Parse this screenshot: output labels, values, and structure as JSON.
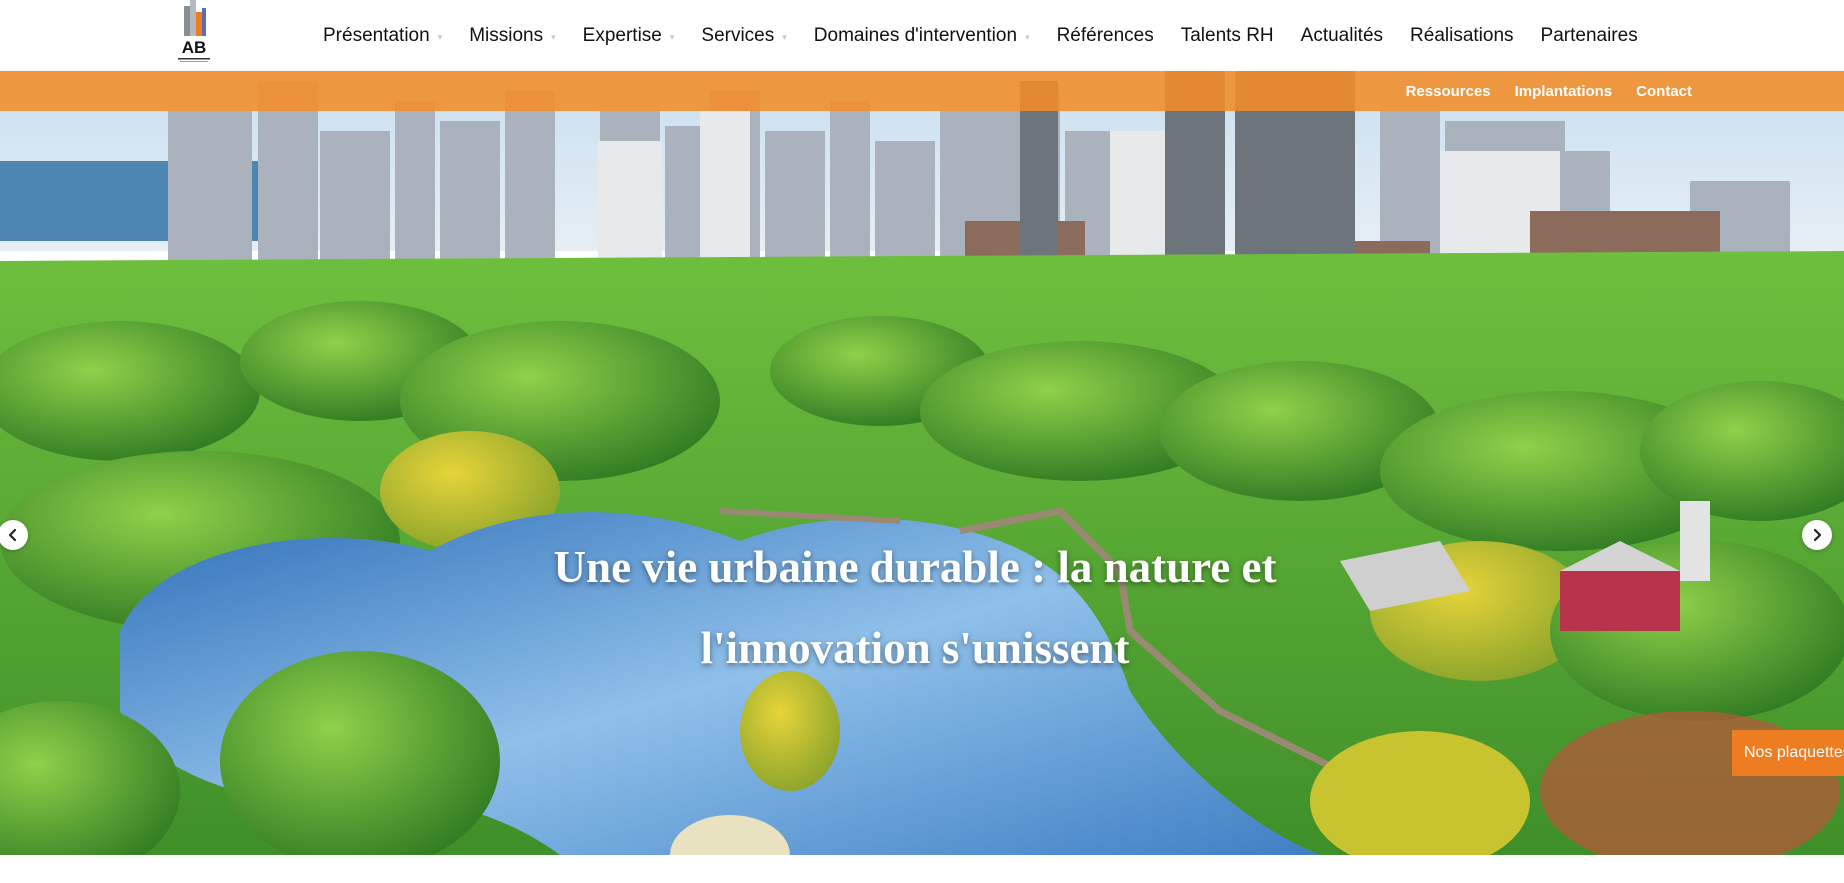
{
  "header": {
    "logo_text": "AB",
    "menu": [
      {
        "label": "Présentation",
        "has_dropdown": true
      },
      {
        "label": "Missions",
        "has_dropdown": true
      },
      {
        "label": "Expertise",
        "has_dropdown": true
      },
      {
        "label": "Services",
        "has_dropdown": true
      },
      {
        "label": "Domaines d'intervention",
        "has_dropdown": true
      },
      {
        "label": "Références",
        "has_dropdown": false
      },
      {
        "label": "Talents RH",
        "has_dropdown": false
      },
      {
        "label": "Actualités",
        "has_dropdown": false
      },
      {
        "label": "Réalisations",
        "has_dropdown": false
      },
      {
        "label": "Partenaires",
        "has_dropdown": false
      }
    ]
  },
  "subbar": {
    "links": [
      "Ressources",
      "Implantations",
      "Contact"
    ],
    "color": "#f28c28"
  },
  "hero": {
    "title_line1": "Une vie urbaine durable : la nature et",
    "title_line2": "l'innovation s'unissent",
    "prev_icon": "chevron-left-icon",
    "next_icon": "chevron-right-icon"
  },
  "floating": {
    "brochure_label": "Nos plaquettes"
  },
  "colors": {
    "accent": "#ee7d22",
    "text": "#111111"
  }
}
